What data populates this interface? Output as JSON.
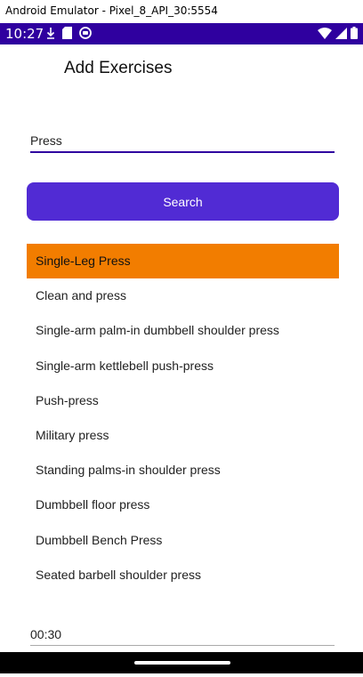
{
  "window": {
    "title": "Android Emulator - Pixel_8_API_30:5554"
  },
  "statusbar": {
    "time": "10:27",
    "icons_left": [
      "download-icon",
      "sd-card-icon",
      "app-notification-icon"
    ],
    "icons_right": [
      "wifi-icon",
      "cell-signal-icon",
      "battery-icon"
    ],
    "background": "#2f009f"
  },
  "page": {
    "title": "Add Exercises"
  },
  "search": {
    "value": "Press"
  },
  "search_button": {
    "label": "Search",
    "color": "#512bd4"
  },
  "exercises": {
    "selected_index": 0,
    "selected_color": "#f27d00",
    "items": [
      "Single-Leg Press",
      "Clean and press",
      "Single-arm palm-in dumbbell shoulder press",
      "Single-arm kettlebell push-press",
      "Push-press",
      "Military press",
      "Standing palms-in shoulder press",
      "Dumbbell floor press",
      "Dumbbell Bench Press",
      "Seated barbell shoulder press"
    ]
  },
  "duration": {
    "value": "00:30"
  }
}
